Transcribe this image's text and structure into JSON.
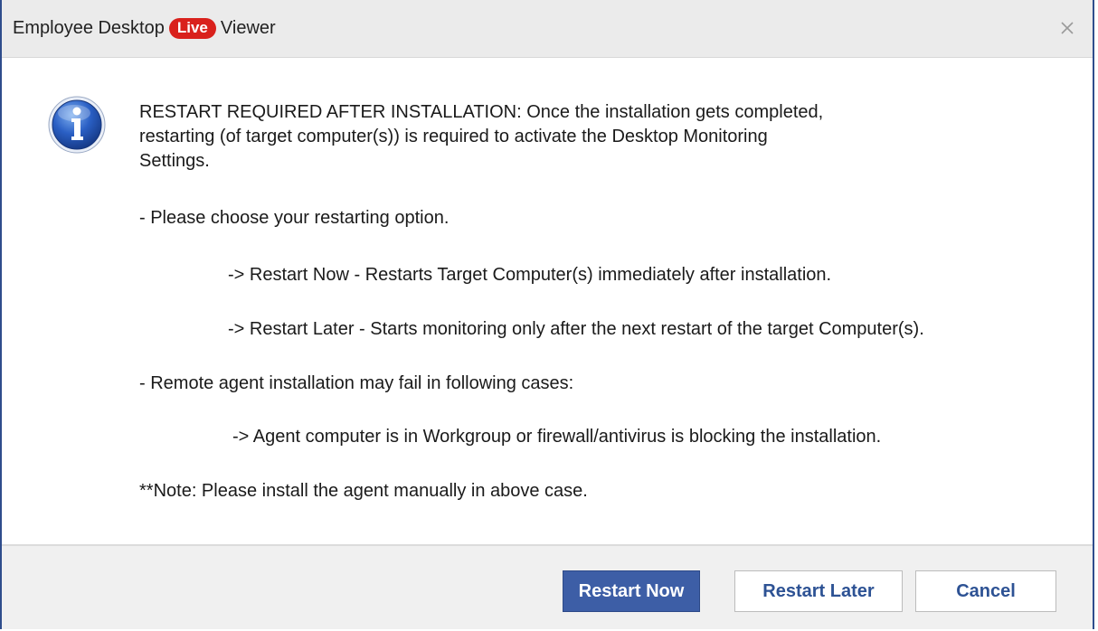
{
  "window": {
    "title_prefix": "Employee Desktop",
    "badge": "Live",
    "title_suffix": "Viewer",
    "close_glyph": "×",
    "colors": {
      "frame": "#2f4d8c",
      "badge": "#d9211c",
      "primary": "#3d5ea6",
      "button_text": "#2d5294"
    }
  },
  "icon": {
    "name": "info-icon",
    "glyph": "i"
  },
  "message": {
    "line1": "RESTART REQUIRED AFTER INSTALLATION: Once the installation gets completed,",
    "line2": "restarting (of target computer(s)) is required to activate the Desktop Monitoring",
    "line3": "Settings.",
    "choose": " - Please choose your restarting option.",
    "option_now": "-> Restart Now - Restarts Target Computer(s) immediately after installation.",
    "option_later": "-> Restart Later - Starts monitoring only after the next restart of the target Computer(s).",
    "fail_intro": "- Remote agent installation may fail in following cases:",
    "fail_case": "-> Agent computer is in Workgroup or firewall/antivirus is blocking the installation.",
    "note": "**Note: Please install the agent manually in above case."
  },
  "buttons": {
    "restart_now": "Restart Now",
    "restart_later": "Restart Later",
    "cancel": "Cancel"
  }
}
